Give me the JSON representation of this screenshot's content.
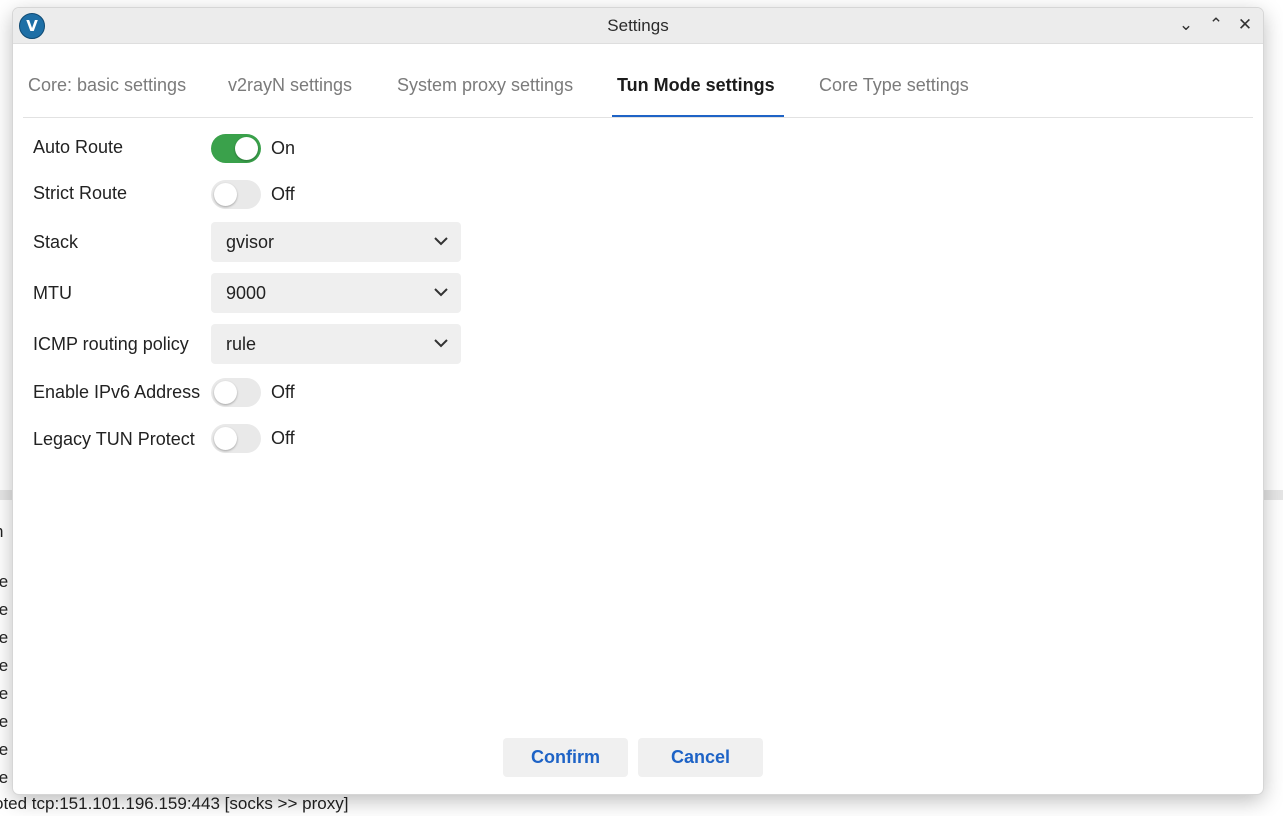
{
  "window": {
    "title": "Settings",
    "app_logo_letter": "V",
    "controls": {
      "minimize": "⌄",
      "maximize": "⌃",
      "close": "✕"
    }
  },
  "tabs": [
    {
      "label": "Core: basic settings",
      "active": false
    },
    {
      "label": "v2rayN settings",
      "active": false
    },
    {
      "label": "System proxy settings",
      "active": false
    },
    {
      "label": "Tun Mode settings",
      "active": true
    },
    {
      "label": "Core Type settings",
      "active": false
    }
  ],
  "form": {
    "auto_route": {
      "label": "Auto Route",
      "state": "On",
      "on": true
    },
    "strict_route": {
      "label": "Strict Route",
      "state": "Off",
      "on": false
    },
    "stack": {
      "label": "Stack",
      "value": "gvisor"
    },
    "mtu": {
      "label": "MTU",
      "value": "9000"
    },
    "icmp": {
      "label": "ICMP routing policy",
      "value": "rule"
    },
    "ipv6": {
      "label": "Enable IPv6 Address",
      "state": "Off",
      "on": false
    },
    "legacy_tun": {
      "label": "Legacy TUN Protect",
      "state": "Off",
      "on": false
    }
  },
  "buttons": {
    "confirm": "Confirm",
    "cancel": "Cancel"
  },
  "background_log": {
    "lines": [
      "n",
      "te",
      "te",
      "te",
      "te",
      "te",
      "te",
      "te",
      "te",
      "oted tcp:151.101.196.159:443 [socks >> proxy]"
    ]
  },
  "colors": {
    "accent": "#1e63c6",
    "toggle_on": "#3aa14b"
  }
}
